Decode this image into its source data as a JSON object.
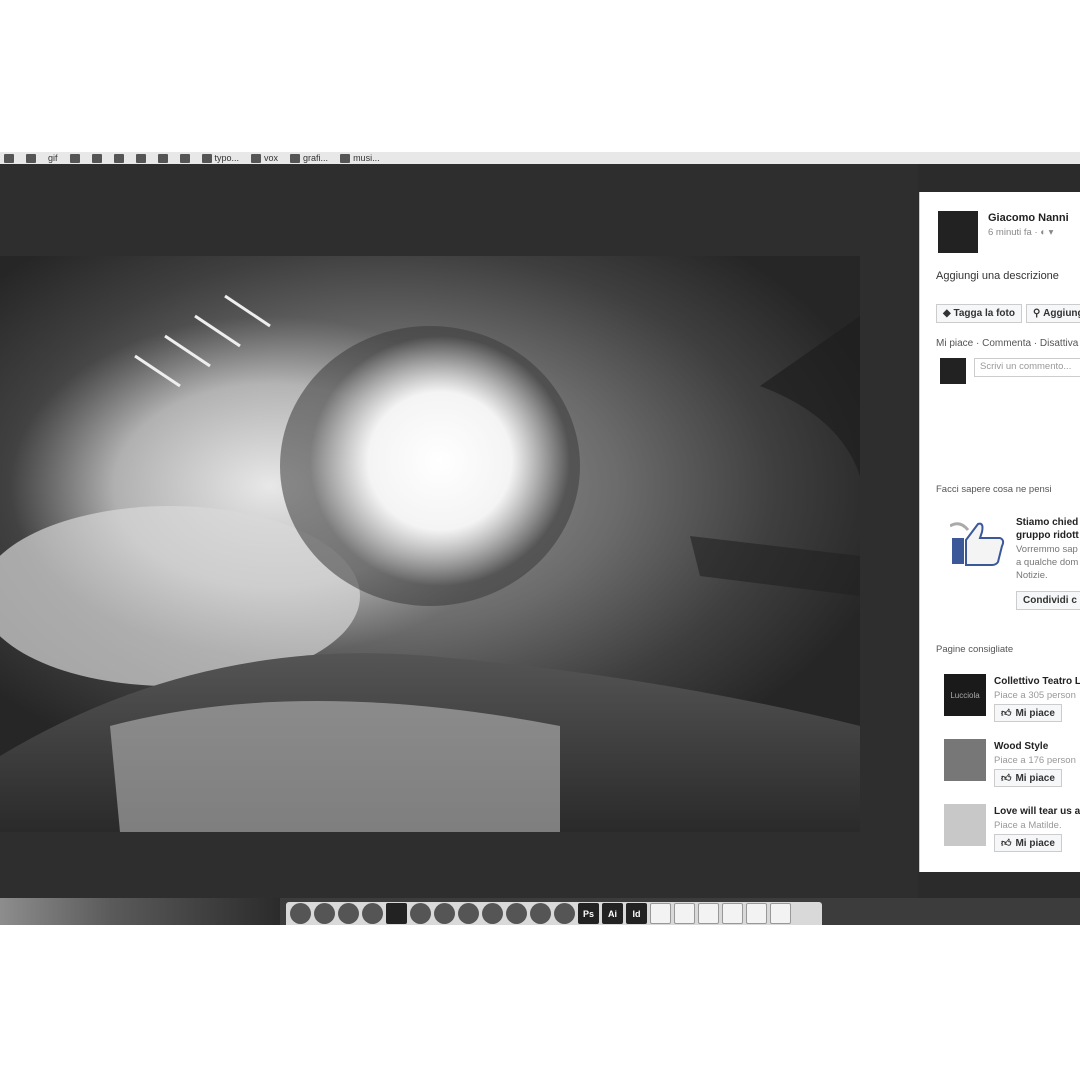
{
  "bookmarks": [
    {
      "label": "gif"
    },
    {
      "label": "typo..."
    },
    {
      "label": "vox"
    },
    {
      "label": "grafi..."
    },
    {
      "label": "musi..."
    }
  ],
  "post": {
    "author": "Giacomo Nanni",
    "time": "6 minuti fa ·",
    "description": "Aggiungi una descrizione",
    "tag_button": "Tagga la foto",
    "location_button": "Aggiung",
    "actions": "Mi piace · Commenta · Disattiva",
    "comment_placeholder": "Scrivi un commento..."
  },
  "feedback": {
    "heading": "Facci sapere cosa ne pensi",
    "title_line1": "Stiamo chied",
    "title_line2": "gruppo ridott",
    "text_line1": "Vorremmo sap",
    "text_line2": "a qualche dom",
    "text_line3": "Notizie.",
    "share_button": "Condividi c"
  },
  "suggested": {
    "heading": "Pagine consigliate",
    "pages": [
      {
        "name": "Collettivo Teatro L",
        "likes": "Piace a 305 person",
        "button": "Mi piace",
        "thumb_text": "Lucciola"
      },
      {
        "name": "Wood Style",
        "likes": "Piace a 176 person",
        "button": "Mi piace"
      },
      {
        "name": "Love will tear us a",
        "likes": "Piace a Matilde.",
        "button": "Mi piace"
      }
    ]
  },
  "dock": {
    "items": [
      "finder-icon",
      "launchpad-icon",
      "preview-icon",
      "chrome-icon",
      "photos-icon",
      "spotify-icon",
      "f-icon",
      "messenger-icon",
      "whatsapp-icon",
      "s-icon",
      "c-icon",
      "app-icon",
      "Ps",
      "Ai",
      "Id",
      "notes-icon",
      "textedit-icon",
      "folder-icon",
      "folder-icon",
      "folder-icon",
      "trash-icon"
    ]
  }
}
